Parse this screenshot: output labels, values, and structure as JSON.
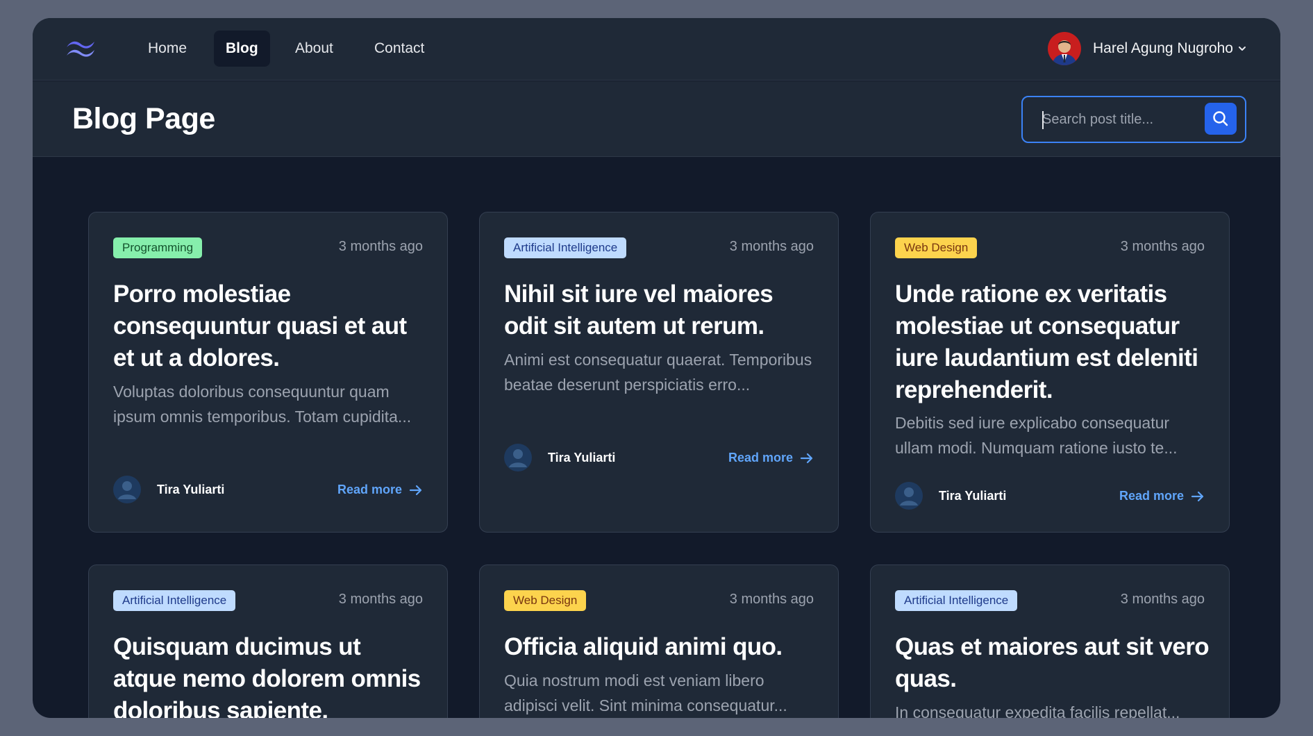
{
  "nav": {
    "links": [
      "Home",
      "Blog",
      "About",
      "Contact"
    ],
    "active": "Blog",
    "user_name": "Harel Agung Nugroho"
  },
  "header": {
    "title": "Blog Page",
    "search_placeholder": "Search post title..."
  },
  "colors": {
    "accent": "#2563eb",
    "link": "#60a5fa",
    "badge_programming": "#86efac",
    "badge_ai": "#bfdbfe",
    "badge_web_design": "#fcd34d"
  },
  "posts": [
    {
      "category": "Programming",
      "date": "3 months ago",
      "title": "Porro molestiae consequuntur quasi et aut et ut a dolores.",
      "excerpt": "Voluptas doloribus consequuntur quam ipsum omnis temporibus. Totam cupidita...",
      "author": "Tira Yuliarti",
      "read_more": "Read more"
    },
    {
      "category": "Artificial Intelligence",
      "date": "3 months ago",
      "title": "Nihil sit iure vel maiores odit sit autem ut rerum.",
      "excerpt": "Animi est consequatur quaerat. Temporibus beatae deserunt perspiciatis erro...",
      "author": "Tira Yuliarti",
      "read_more": "Read more"
    },
    {
      "category": "Web Design",
      "date": "3 months ago",
      "title": "Unde ratione ex veritatis molestiae ut consequatur iure laudantium est deleniti reprehenderit.",
      "excerpt": "Debitis sed iure explicabo consequatur ullam modi. Numquam ratione iusto te...",
      "author": "Tira Yuliarti",
      "read_more": "Read more"
    },
    {
      "category": "Artificial Intelligence",
      "date": "3 months ago",
      "title": "Quisquam ducimus ut atque nemo dolorem omnis doloribus sapiente.",
      "excerpt": "",
      "author": "",
      "read_more": ""
    },
    {
      "category": "Web Design",
      "date": "3 months ago",
      "title": "Officia aliquid animi quo.",
      "excerpt": "Quia nostrum modi est veniam libero adipisci velit. Sint minima consequatur...",
      "author": "",
      "read_more": ""
    },
    {
      "category": "Artificial Intelligence",
      "date": "3 months ago",
      "title": "Quas et maiores aut sit vero quas.",
      "excerpt": "In consequatur expedita facilis repellat...",
      "author": "",
      "read_more": ""
    }
  ]
}
